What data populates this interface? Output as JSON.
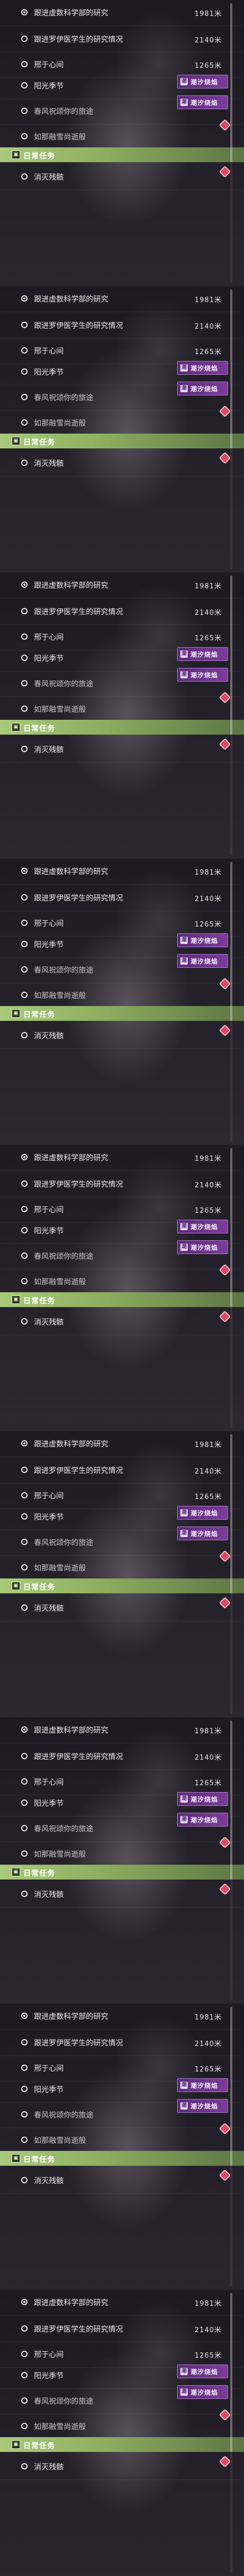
{
  "tasks": [
    {
      "name": "跟进虚数科学部的研究",
      "distance": "1981米"
    },
    {
      "name": "跟进罗伊医学生的研究情况",
      "distance": "2140米"
    },
    {
      "name": "邢于心间",
      "distance": "1265米"
    },
    {
      "name": "阳光季节",
      "distance": ""
    },
    {
      "name": "春风祝颂你的旅途",
      "distance": ""
    },
    {
      "name": "如那融雪尚逝般",
      "distance": ""
    }
  ],
  "badge_label": "潮汐烧焰",
  "badge_icon": "潮",
  "daily_section": {
    "title": "日常任务",
    "icon": "daily-task-icon",
    "tasks": [
      {
        "name": "消灭残骸"
      }
    ]
  },
  "colors": {
    "badge": "#6b3388",
    "daily_bar": "#a9c97c",
    "claim_mark": "#d84a63"
  },
  "icons": [
    "track-circle-icon",
    "event-badge-icon",
    "daily-task-icon",
    "claim-diamond-icon",
    "scrollbar"
  ]
}
